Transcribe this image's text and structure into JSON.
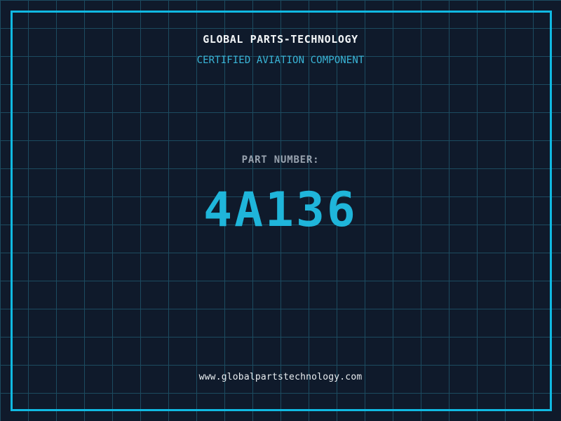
{
  "colors": {
    "background": "#0f1a2b",
    "grid_line": "#1c4b60",
    "frame": "#10b9e2",
    "title": "#f2f5f7",
    "subtitle": "#3ab6d8",
    "part_label": "#98a2ae",
    "part_number": "#1fb5da",
    "url": "#e9edf0"
  },
  "header": {
    "title": "GLOBAL PARTS-TECHNOLOGY",
    "subtitle": "CERTIFIED AVIATION COMPONENT"
  },
  "part": {
    "label": "PART NUMBER:",
    "number": "4A136"
  },
  "footer": {
    "url": "www.globalpartstechnology.com"
  }
}
